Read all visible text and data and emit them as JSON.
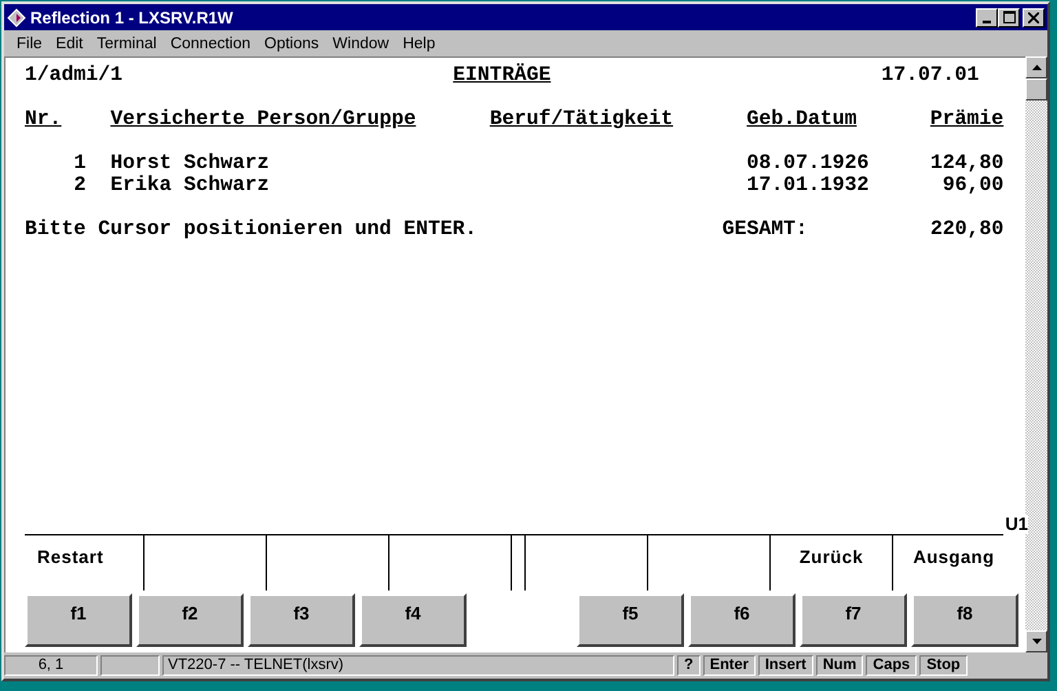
{
  "window": {
    "title": "Reflection 1 - LXSRV.R1W"
  },
  "menu": [
    "File",
    "Edit",
    "Terminal",
    "Connection",
    "Options",
    "Window",
    "Help"
  ],
  "screen": {
    "session": "1/admi/1",
    "title": "EINTRÄGE",
    "date": "17.07.01",
    "columns": [
      "Nr.",
      "Versicherte Person/Gruppe",
      "Beruf/Tätigkeit",
      "Geb.Datum",
      "Prämie"
    ],
    "rows": [
      {
        "nr": "1",
        "name": "Horst Schwarz",
        "birth": "08.07.1926",
        "premium": "124,80"
      },
      {
        "nr": "2",
        "name": "Erika Schwarz",
        "birth": "17.01.1932",
        "premium": "96,00"
      }
    ],
    "message": "Bitte Cursor positionieren und ENTER.",
    "total_label": "GESAMT:",
    "total": "220,80",
    "screen_id": "U1"
  },
  "function_keys": [
    {
      "key": "f1",
      "label": "Restart"
    },
    {
      "key": "f2"
    },
    {
      "key": "f3"
    },
    {
      "key": "f4"
    },
    {
      "key": "f5"
    },
    {
      "key": "f6"
    },
    {
      "key": "f7",
      "label": "Zurück"
    },
    {
      "key": "f8",
      "label": "Ausgang"
    }
  ],
  "status_bar": {
    "cursor": "6, 1",
    "connection": "VT220-7 -- TELNET(lxsrv)",
    "indicators": [
      "?",
      "Enter",
      "Insert",
      "Num",
      "Caps",
      "Stop"
    ]
  }
}
